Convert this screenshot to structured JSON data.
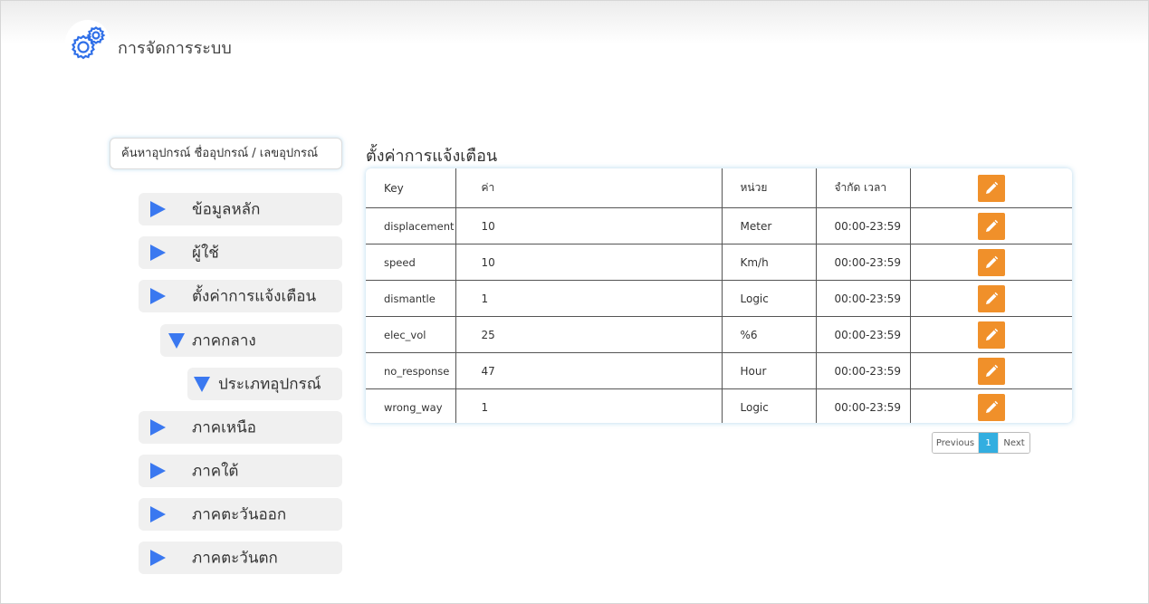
{
  "header": {
    "title": "การจัดการระบบ",
    "icon": "gears-icon"
  },
  "search": {
    "placeholder": "ค้นหาอุปกรณ์ ชื่ออุปกรณ์ / เลขอุปกรณ์"
  },
  "sidebar": {
    "items": [
      {
        "label": "ข้อมูลหลัก",
        "state": "collapsed"
      },
      {
        "label": "ผู้ใช้",
        "state": "collapsed"
      },
      {
        "label": "ตั้งค่าการแจ้งเตือน",
        "state": "collapsed"
      },
      {
        "label": "ภาคกลาง",
        "state": "expanded"
      },
      {
        "label": "ประเภทอุปกรณ์",
        "state": "expanded"
      },
      {
        "label": "ภาคเหนือ",
        "state": "collapsed"
      },
      {
        "label": "ภาคใต้",
        "state": "collapsed"
      },
      {
        "label": "ภาคตะวันออก",
        "state": "collapsed"
      },
      {
        "label": "ภาคตะวันตก",
        "state": "collapsed"
      }
    ]
  },
  "section": {
    "title": "ตั้งค่าการแจ้งเตือน"
  },
  "table": {
    "headers": {
      "key": "Key",
      "value": "ค่า",
      "unit": "หน่วย",
      "time": "จำกัด เวลา"
    },
    "rows": [
      {
        "key": "displacement",
        "value": "10",
        "unit": "Meter",
        "time": "00:00-23:59"
      },
      {
        "key": "speed",
        "value": "10",
        "unit": "Km/h",
        "time": "00:00-23:59"
      },
      {
        "key": "dismantle",
        "value": "1",
        "unit": "Logic",
        "time": "00:00-23:59"
      },
      {
        "key": "elec_vol",
        "value": "25",
        "unit": "%6",
        "time": "00:00-23:59"
      },
      {
        "key": "no_response",
        "value": "47",
        "unit": "Hour",
        "time": "00:00-23:59"
      },
      {
        "key": "wrong_way",
        "value": "1",
        "unit": "Logic",
        "time": "00:00-23:59"
      }
    ]
  },
  "pagination": {
    "previous": "Previous",
    "current": "1",
    "next": "Next"
  },
  "colors": {
    "accent_blue": "#3a78f0",
    "edit_orange": "#f0902a",
    "page_active": "#33aee0"
  }
}
